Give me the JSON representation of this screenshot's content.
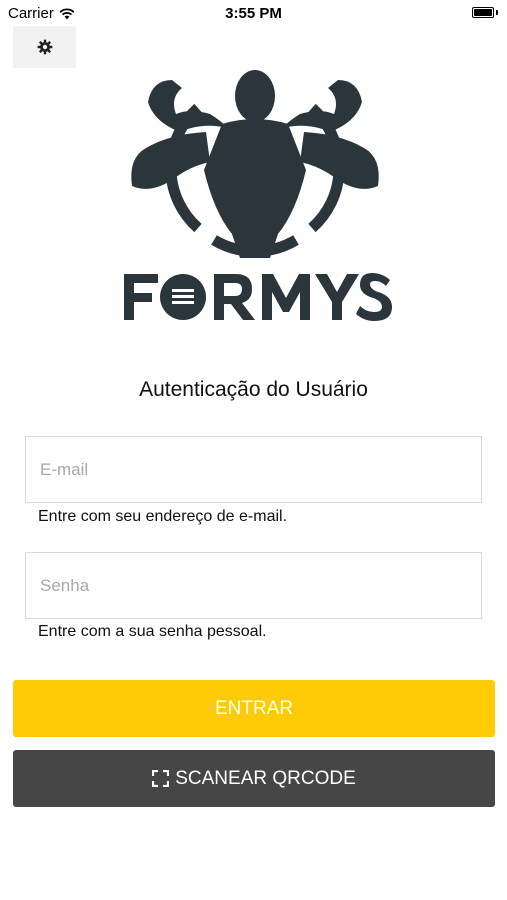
{
  "status_bar": {
    "carrier": "Carrier",
    "time": "3:55 PM",
    "wifi_icon": "wifi-icon",
    "battery_icon": "battery-icon"
  },
  "toolbar": {
    "settings_icon": "gear-icon"
  },
  "logo": {
    "text": "FORMYS",
    "icon": "bodybuilder-logo",
    "color": "#2b353c"
  },
  "auth": {
    "title": "Autenticação do Usuário",
    "email": {
      "placeholder": "E-mail",
      "value": "",
      "hint": "Entre com seu endereço de e-mail."
    },
    "password": {
      "placeholder": "Senha",
      "value": "",
      "hint": "Entre com a sua senha pessoal."
    }
  },
  "buttons": {
    "login_label": "ENTRAR",
    "login_color": "#ffcb05",
    "qr_label": "SCANEAR QRCODE",
    "qr_icon": "qr-scan-icon",
    "qr_color": "#464646"
  }
}
